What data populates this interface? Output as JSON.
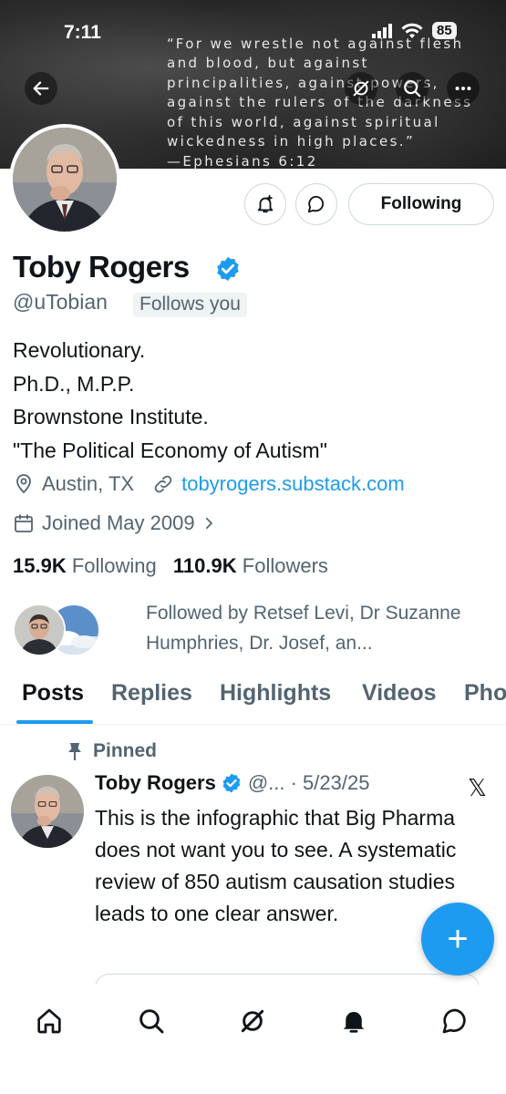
{
  "status_bar": {
    "time": "7:11",
    "battery": "85"
  },
  "banner": {
    "quote": "“For we wrestle not against flesh\nand blood, but against\nprincipalities, against powers,\nagainst the rulers of the darkness\nof this world, against spiritual\nwickedness in high places.”",
    "reference": "—Ephesians 6:12"
  },
  "profile": {
    "name": "Toby Rogers",
    "handle": "@uTobian",
    "follows_you": "Follows you",
    "bio_lines": [
      "Revolutionary.",
      "Ph.D., M.P.P.",
      "Brownstone Institute.",
      "\"The Political Economy of Autism\""
    ],
    "location": "Austin, TX",
    "website": "tobyrogers.substack.com",
    "joined": "Joined May 2009",
    "following_count": "15.9K",
    "following_label": "Following",
    "followers_count": "110.9K",
    "followers_label": "Followers",
    "followed_by": "Followed by Retsef Levi, Dr Suzanne Humphries, Dr. Josef, an..."
  },
  "actions": {
    "following_button": "Following"
  },
  "tabs": [
    "Posts",
    "Replies",
    "Highlights",
    "Videos",
    "Pho"
  ],
  "pinned_post": {
    "pinned_label": "Pinned",
    "author": "Toby Rogers",
    "meta": "@... · 5/23/25",
    "text": "This is the infographic that Big Pharma does not want you to see. A systematic review of 850 autism causation studies leads to one clear answer."
  },
  "fab_label": "+",
  "colors": {
    "accent": "#1d9bf0",
    "text": "#0f1419",
    "muted": "#536471"
  }
}
